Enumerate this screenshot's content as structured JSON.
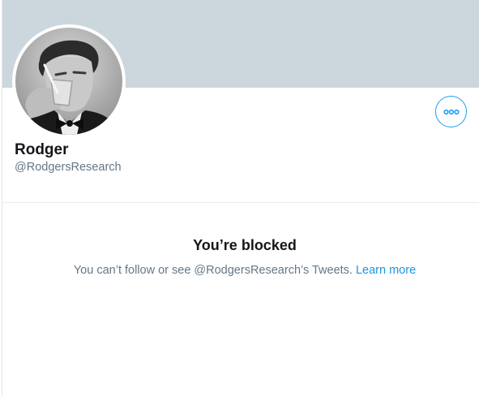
{
  "profile": {
    "banner_color": "#ccd6dd",
    "avatar_icon": "profile-photo",
    "more_icon": "more-horizontal-icon",
    "display_name": "Rodger",
    "handle": "@RodgersResearch"
  },
  "blocked": {
    "title": "You’re blocked",
    "message": "You can’t follow or see @RodgersResearch’s Tweets.",
    "link_label": "Learn more"
  },
  "colors": {
    "accent": "#1da1f2",
    "link": "#1b95e0",
    "text_primary": "#14171a",
    "text_secondary": "#657786"
  }
}
